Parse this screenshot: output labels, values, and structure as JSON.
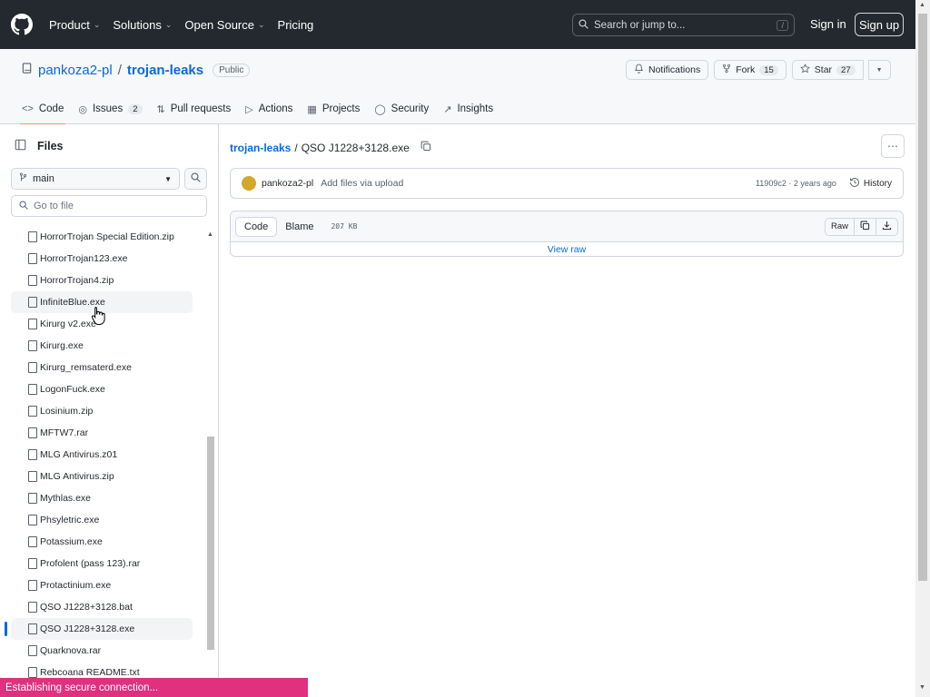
{
  "header": {
    "nav": [
      {
        "label": "Product",
        "dropdown": true
      },
      {
        "label": "Solutions",
        "dropdown": true
      },
      {
        "label": "Open Source",
        "dropdown": true
      },
      {
        "label": "Pricing",
        "dropdown": false
      }
    ],
    "search_placeholder": "Search or jump to...",
    "search_shortcut": "/",
    "sign_in": "Sign in",
    "sign_up": "Sign up"
  },
  "repo": {
    "owner": "pankoza2-pl",
    "separator": "/",
    "name": "trojan-leaks",
    "visibility": "Public",
    "notifications": "Notifications",
    "fork_label": "Fork",
    "fork_count": "15",
    "star_label": "Star",
    "star_count": "27",
    "tabs": [
      {
        "label": "Code",
        "icon": "code-icon",
        "active": true
      },
      {
        "label": "Issues",
        "icon": "issue-icon",
        "count": "2"
      },
      {
        "label": "Pull requests",
        "icon": "pull-request-icon"
      },
      {
        "label": "Actions",
        "icon": "play-icon"
      },
      {
        "label": "Projects",
        "icon": "table-icon"
      },
      {
        "label": "Security",
        "icon": "shield-icon"
      },
      {
        "label": "Insights",
        "icon": "graph-icon"
      }
    ]
  },
  "sidebar": {
    "title": "Files",
    "branch": "main",
    "goto_placeholder": "Go to file",
    "files": [
      "HorrorTrojan Special Edition.zip",
      "HorrorTrojan123.exe",
      "HorrorTrojan4.zip",
      "InfiniteBlue.exe",
      "Kirurg v2.exe",
      "Kirurg.exe",
      "Kirurg_remsaterd.exe",
      "LogonFuck.exe",
      "Losinium.zip",
      "MFTW7.rar",
      "MLG Antivirus.z01",
      "MLG Antivirus.zip",
      "Mythlas.exe",
      "Phsyletric.exe",
      "Potassium.exe",
      "Profolent (pass 123).rar",
      "Protactinium.exe",
      "QSO J1228+3128.bat",
      "QSO J1228+3128.exe",
      "Quarknova.rar",
      "Rebcoana README.txt"
    ],
    "hover_index": 3,
    "selected_index": 18
  },
  "main": {
    "crumb_repo": "trojan-leaks",
    "crumb_sep": "/",
    "crumb_file": "QSO J1228+3128.exe",
    "commit_author": "pankoza2-pl",
    "commit_message": "Add files via upload",
    "commit_meta": "11909c2 · 2 years ago",
    "history": "History",
    "code_tab": "Code",
    "blame_tab": "Blame",
    "file_size": "207 KB",
    "raw": "Raw",
    "view_raw": "View raw"
  },
  "status": "Establishing secure connection..."
}
